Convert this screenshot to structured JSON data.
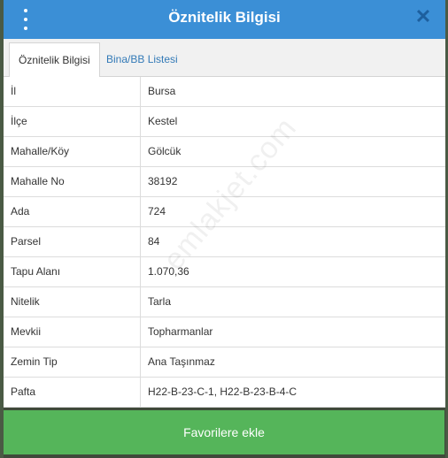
{
  "header": {
    "title": "Öznitelik Bilgisi",
    "close_symbol": "✕"
  },
  "tabs": [
    {
      "label": "Öznitelik Bilgisi",
      "active": true
    },
    {
      "label": "Bina/BB Listesi",
      "active": false
    }
  ],
  "rows": [
    {
      "key": "İl",
      "value": "Bursa"
    },
    {
      "key": "İlçe",
      "value": "Kestel"
    },
    {
      "key": "Mahalle/Köy",
      "value": "Gölcük"
    },
    {
      "key": "Mahalle No",
      "value": "38192"
    },
    {
      "key": "Ada",
      "value": "724"
    },
    {
      "key": "Parsel",
      "value": "84"
    },
    {
      "key": "Tapu Alanı",
      "value": "1.070,36"
    },
    {
      "key": "Nitelik",
      "value": "Tarla"
    },
    {
      "key": "Mevkii",
      "value": "Topharmanlar"
    },
    {
      "key": "Zemin Tip",
      "value": "Ana Taşınmaz"
    },
    {
      "key": "Pafta",
      "value": "H22-B-23-C-1, H22-B-23-B-4-C"
    }
  ],
  "footer": {
    "favorite_label": "Favorilere ekle"
  },
  "watermark": "emlakjet.com",
  "colors": {
    "header": "#3b8fd6",
    "button": "#55b55a",
    "link": "#337ab7"
  }
}
